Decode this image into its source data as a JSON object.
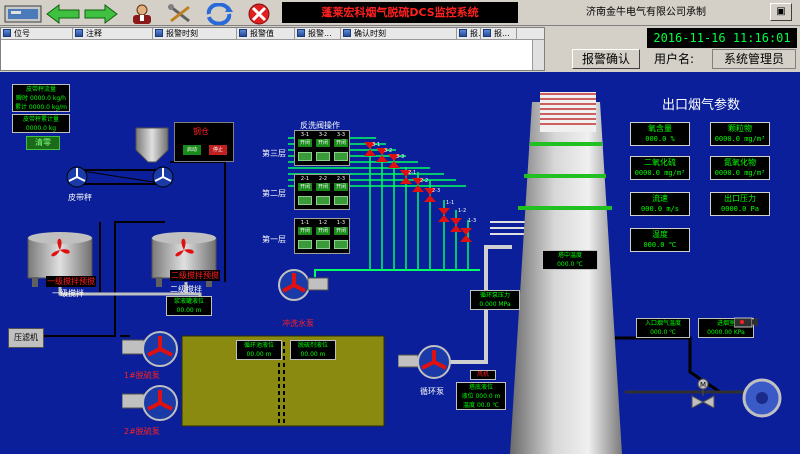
{
  "header": {
    "system_title": "蓬莱宏科烟气脱硫DCS监控系统",
    "vendor": "济南金牛电气有限公司承制",
    "win_ctrl": "▣"
  },
  "alarm": {
    "columns": [
      "位号",
      "注释",
      "报警时刻",
      "报警值",
      "报警...",
      "确认时刻",
      "报...",
      "报..."
    ]
  },
  "status": {
    "datetime": "2016-11-16 11:16:01",
    "ack_label": "报警确认",
    "user_label": "用户名:",
    "user_value": "系统管理员"
  },
  "belt": {
    "flow_label": "皮带秤流量",
    "flow_rows": [
      "瞬时 0000.0 kg/h",
      "累计 0000.0 kg/m"
    ],
    "total_label": "皮带秤累计量",
    "total_value": "0000.0 kg",
    "clear_label": "清零",
    "scale_label": "皮带秤"
  },
  "silo": {
    "panel_title": "钢仓",
    "start_label": "启动",
    "stop_label": "停止"
  },
  "tanks": {
    "tank1_red": "一级搅拌预搅",
    "tank1_label": "一级搅拌",
    "tank2_red": "二级搅拌预搅",
    "tank2_label": "二级搅拌",
    "level_label": "浆液罐液位",
    "level_value": "00.00  m"
  },
  "filter": {
    "label": "压滤机"
  },
  "pumps": {
    "pump1_label": "1#脱硫泵",
    "pump2_label": "2#脱硫泵",
    "flush_label": "冲洗水泵",
    "circ_label": "循环泵"
  },
  "pond": {
    "box1_label": "循环池液位",
    "box1_value": "00.00  m",
    "box2_label": "脱硫剂液位",
    "box2_value": "00.00  m"
  },
  "backwash": {
    "title": "反洗阀操作",
    "layers": [
      {
        "name": "第三层",
        "ids": [
          "3-1",
          "3-2",
          "3-3"
        ]
      },
      {
        "name": "第二层",
        "ids": [
          "2-1",
          "2-2",
          "2-3"
        ]
      },
      {
        "name": "第一层",
        "ids": [
          "1-1",
          "1-2",
          "1-3"
        ]
      }
    ],
    "btn_label": "开闭",
    "valve_ids": [
      "3-1",
      "3-2",
      "3-3",
      "2-1",
      "2-2",
      "2-3",
      "1-1",
      "1-2",
      "1-3"
    ]
  },
  "tower": {
    "temp_label": "塔中温度",
    "temp_value": "000.0  ℃",
    "press_label": "循环泵压力",
    "press_value": "0.000  MPa",
    "fan_label": "风机",
    "fan_value": "",
    "bottom_label": "塔底液位",
    "bottom_rows": [
      "液位 000.0 m",
      "温度 00.0  ℃"
    ]
  },
  "outlet": {
    "title": "出口烟气参数",
    "params": [
      {
        "label": "氧含量",
        "value": "000.0 %"
      },
      {
        "label": "颗粒物",
        "value": "0000.0 mg/m³"
      },
      {
        "label": "二氧化硫",
        "value": "0000.0 mg/m³"
      },
      {
        "label": "氮氧化物",
        "value": "0000.0 mg/m³"
      },
      {
        "label": "流速",
        "value": "000.0 m/s"
      },
      {
        "label": "出口压力",
        "value": "0000.0 Pa"
      },
      {
        "label": "温度",
        "value": "000.0 ℃"
      }
    ]
  },
  "inlet": {
    "temp_label": "入口烟气温度",
    "temp_value": "000.0  ℃",
    "press_label": "进烟室",
    "press_value": "0000.00 KPa"
  },
  "colors": {
    "background": "#0a1f99",
    "value_text": "#00ff00",
    "alarm_red": "#ff2020",
    "pipe_green": "#00ff60"
  }
}
